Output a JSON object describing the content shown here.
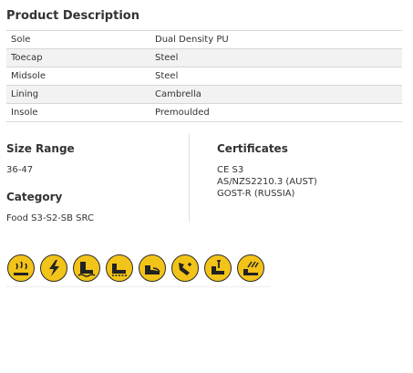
{
  "description": {
    "title": "Product Description",
    "rows": [
      {
        "key": "Sole",
        "value": "Dual Density PU"
      },
      {
        "key": "Toecap",
        "value": "Steel"
      },
      {
        "key": "Midsole",
        "value": "Steel"
      },
      {
        "key": "Lining",
        "value": "Cambrella"
      },
      {
        "key": "Insole",
        "value": "Premoulded"
      }
    ]
  },
  "size_range": {
    "heading": "Size Range",
    "value": "36-47"
  },
  "category": {
    "heading": "Category",
    "value": "Food S3-S2-SB SRC"
  },
  "certificates": {
    "heading": "Certificates",
    "items": [
      "CE S3",
      "AS/NZS2210.3 (AUST)",
      "GOST-R (RUSSIA)"
    ]
  },
  "feature_icons": {
    "accent_color": "#f2c318",
    "items": [
      "hot-surface-icon",
      "antistatic-icon",
      "water-resistant-icon",
      "slip-resistant-icon",
      "steel-toecap-icon",
      "chemical-resistant-icon",
      "penetration-resistant-icon",
      "energy-absorbing-icon"
    ]
  }
}
